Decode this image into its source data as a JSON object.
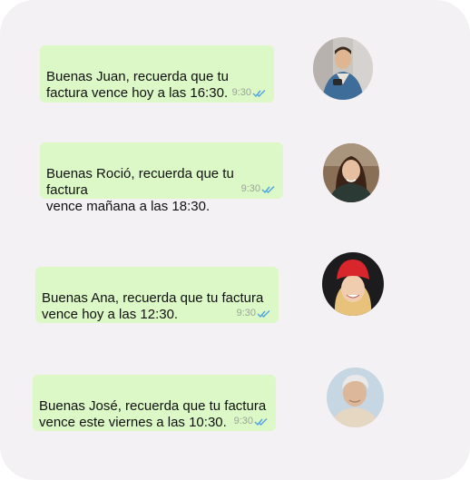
{
  "messages": [
    {
      "text": "Buenas Juan, recuerda que tu\nfactura vence hoy a las 16:30.",
      "time": "9:30",
      "status_icon": "double-check-icon",
      "avatar_icon": "man-avatar-icon"
    },
    {
      "text": "Buenas Roció, recuerda que tu factura\nvence mañana a las 18:30.",
      "time": "9:30",
      "status_icon": "double-check-icon",
      "avatar_icon": "woman-avatar-icon"
    },
    {
      "text": "Buenas Ana, recuerda que tu factura\nvence hoy a las 12:30.",
      "time": "9:30",
      "status_icon": "double-check-icon",
      "avatar_icon": "woman-red-hat-avatar-icon"
    },
    {
      "text": "Buenas José, recuerda que tu factura\nvence este viernes a las 10:30.",
      "time": "9:30",
      "status_icon": "double-check-icon",
      "avatar_icon": "older-man-avatar-icon"
    }
  ],
  "colors": {
    "background": "#f3f1f3",
    "bubble": "#dcf8c6",
    "read_ticks": "#4fa3e3",
    "timestamp": "#9aa39b"
  }
}
